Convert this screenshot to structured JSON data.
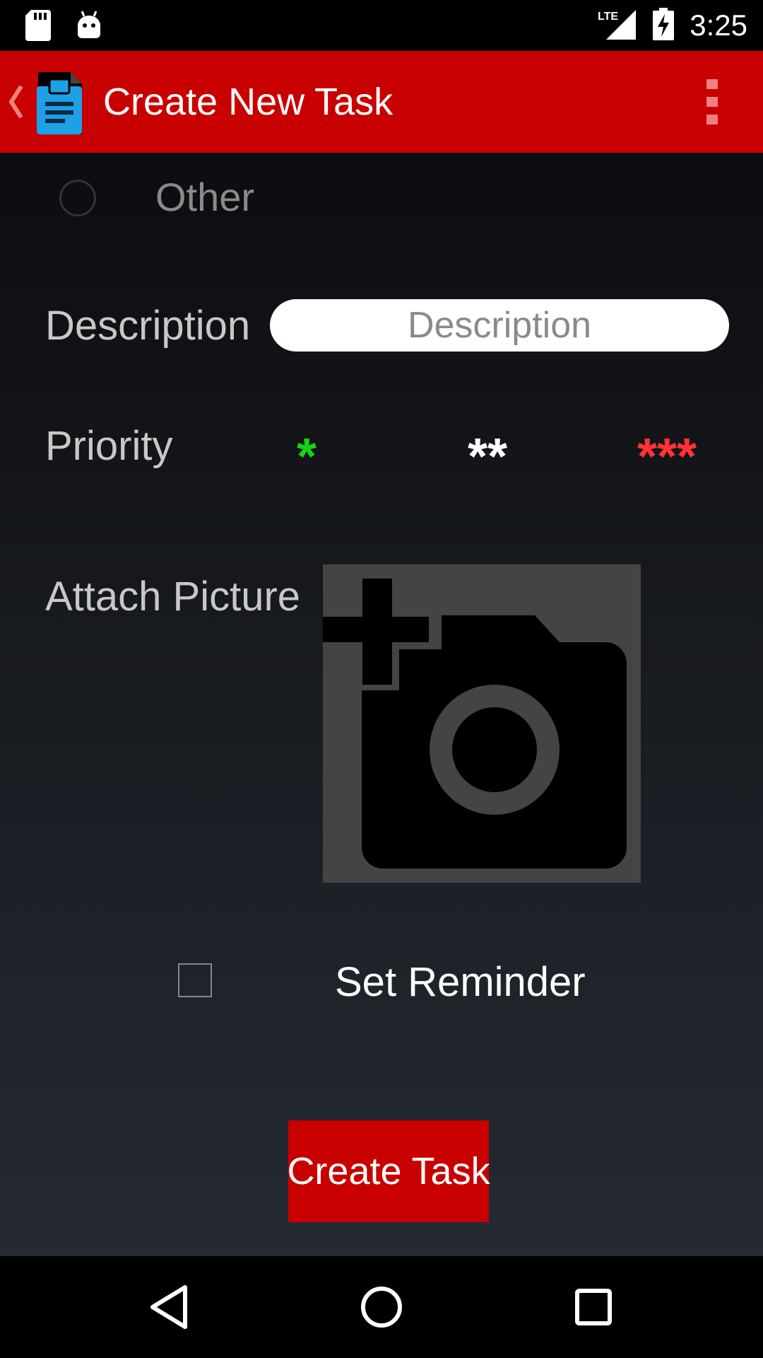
{
  "status_bar": {
    "time": "3:25",
    "network": "LTE",
    "icons": [
      "sd-card-icon",
      "android-icon",
      "lte-signal-icon",
      "battery-charging-icon"
    ]
  },
  "app_bar": {
    "title": "Create New Task",
    "icons": [
      "back-chevron-icon",
      "clipboard-task-icon",
      "overflow-menu-icon"
    ],
    "color": "#c80000"
  },
  "form": {
    "category_option": "Other",
    "description_label": "Description",
    "description_placeholder": "Description",
    "description_value": "",
    "priority_label": "Priority",
    "priority_options": [
      {
        "label": "*",
        "color": "#16d416"
      },
      {
        "label": "**",
        "color": "#ffffff"
      },
      {
        "label": "***",
        "color": "#ff3333"
      }
    ],
    "attach_label": "Attach Picture",
    "attach_icon": "add-a-photo-icon",
    "reminder_label": "Set Reminder",
    "reminder_checked": false,
    "submit_label": "Create Task"
  },
  "nav_bar": {
    "icons": [
      "back-triangle-icon",
      "home-circle-icon",
      "recents-square-icon"
    ]
  }
}
